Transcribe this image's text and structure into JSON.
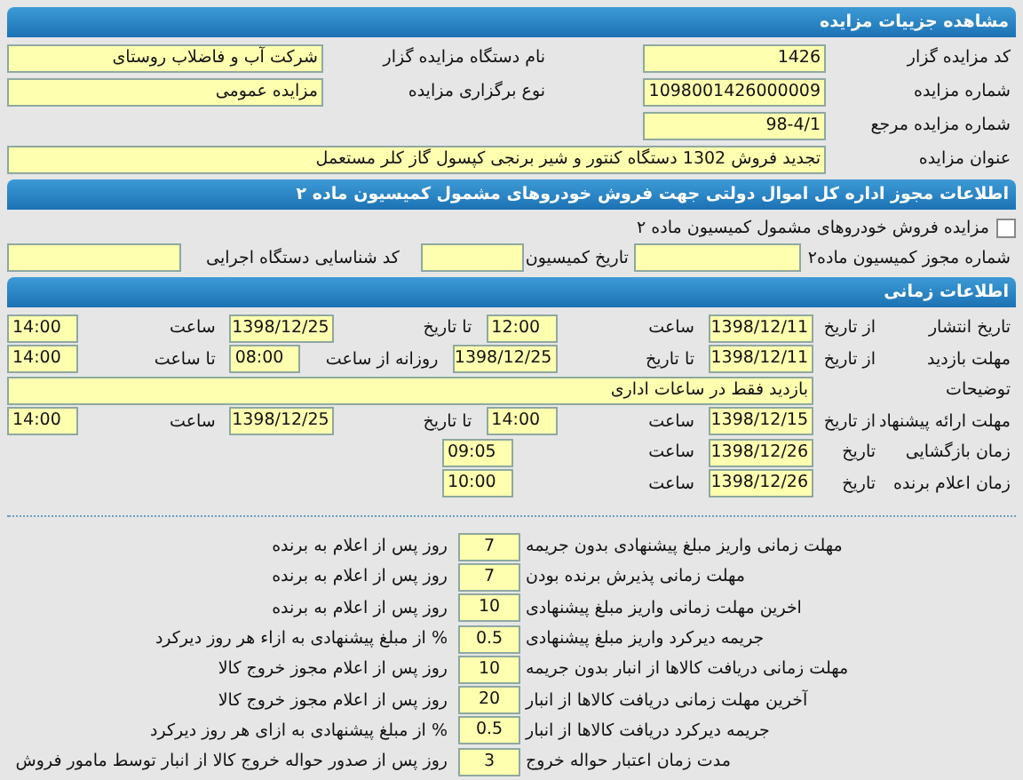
{
  "page_title": "مشاهده جزییات مزایده",
  "general": {
    "right": [
      {
        "label": "کد مزایده گزار",
        "value": "1426"
      },
      {
        "label": "شماره مزایده",
        "value": "1098001426000009"
      },
      {
        "label": "شماره مزایده مرجع",
        "value": "98-4/1"
      }
    ],
    "left": [
      {
        "label": "نام دستگاه مزایده گزار",
        "value": "شرکت آب و فاضلاب روستای"
      },
      {
        "label": "نوع برگزاری مزایده",
        "value": "مزایده عمومی"
      }
    ],
    "subject": {
      "label": "عنوان مزایده",
      "value": "تجدید فروش 1302 دستگاه کنتور و شیر برنجی کپسول گاز کلر مستعمل"
    }
  },
  "commission": {
    "title": "اطلاعات مجوز اداره کل اموال دولتی جهت فروش خودروهای مشمول کمیسیون ماده ۲",
    "checkbox": {
      "label": "مزایده فروش خودروهای مشمول کمیسیون ماده ۲",
      "checked": false
    },
    "fields": [
      {
        "label": "شماره مجوز کمیسیون ماده۲"
      },
      {
        "label": "تاریخ کمیسیون"
      },
      {
        "label": "کد شناسایی دستگاه اجرایی"
      }
    ]
  },
  "schedule": {
    "title": "اطلاعات زمانی",
    "rows": [
      {
        "label": "تاریخ انتشار",
        "parts": [
          {
            "kind": "text",
            "text": "از تاریخ"
          },
          {
            "kind": "date",
            "value": "1398/12/11"
          },
          {
            "kind": "text",
            "text": "ساعت"
          },
          {
            "kind": "time",
            "value": "12:00"
          },
          {
            "kind": "text",
            "text": "تا تاریخ"
          },
          {
            "kind": "date",
            "value": "1398/12/25"
          },
          {
            "kind": "text",
            "text": "ساعت"
          },
          {
            "kind": "time",
            "value": "14:00"
          }
        ]
      },
      {
        "label": "مهلت بازدید",
        "parts": [
          {
            "kind": "text",
            "text": "از تاریخ"
          },
          {
            "kind": "date",
            "value": "1398/12/11"
          },
          {
            "kind": "text",
            "text": "تا تاریخ"
          },
          {
            "kind": "date",
            "value": "1398/12/25"
          },
          {
            "kind": "text",
            "text": "روزانه از ساعت"
          },
          {
            "kind": "time",
            "value": "08:00"
          },
          {
            "kind": "text",
            "text": "تا ساعت"
          },
          {
            "kind": "time",
            "value": "14:00"
          }
        ]
      },
      {
        "label": "توضیحات",
        "parts": [
          {
            "kind": "wide",
            "value": "بازدید فقط در ساعات اداری"
          }
        ]
      },
      {
        "label": "مهلت ارائه پیشنهاد",
        "parts": [
          {
            "kind": "text",
            "text": "از تاریخ"
          },
          {
            "kind": "date",
            "value": "1398/12/15"
          },
          {
            "kind": "text",
            "text": "ساعت"
          },
          {
            "kind": "time",
            "value": "14:00"
          },
          {
            "kind": "text",
            "text": "تا تاریخ"
          },
          {
            "kind": "date",
            "value": "1398/12/25"
          },
          {
            "kind": "text",
            "text": "ساعت"
          },
          {
            "kind": "time",
            "value": "14:00"
          }
        ]
      },
      {
        "label": "زمان بازگشایی",
        "parts": [
          {
            "kind": "text",
            "text": "تاریخ"
          },
          {
            "kind": "date",
            "value": "1398/12/26"
          },
          {
            "kind": "text",
            "text": "ساعت"
          },
          {
            "kind": "time",
            "value": "09:05"
          }
        ]
      },
      {
        "label": "زمان اعلام برنده",
        "parts": [
          {
            "kind": "text",
            "text": "تاریخ"
          },
          {
            "kind": "date",
            "value": "1398/12/26"
          },
          {
            "kind": "text",
            "text": "ساعت"
          },
          {
            "kind": "time",
            "value": "10:00"
          }
        ]
      }
    ]
  },
  "terms": [
    {
      "label": "مهلت زمانی واریز مبلغ پیشنهادی بدون جریمه",
      "value": "7",
      "suffix": "روز پس از اعلام به برنده"
    },
    {
      "label": "مهلت زمانی پذیرش برنده بودن",
      "value": "7",
      "suffix": "روز پس از اعلام به برنده"
    },
    {
      "label": "اخرین مهلت زمانی واریز مبلغ پیشنهادی",
      "value": "10",
      "suffix": "روز پس از اعلام به برنده"
    },
    {
      "label": "جریمه دیرکرد واریز مبلغ پیشنهادی",
      "value": "0.5",
      "suffix": "% از مبلغ پیشنهادی به ازاء هر روز دیرکرد"
    },
    {
      "label": "مهلت زمانی دریافت کالاها از انبار بدون جریمه",
      "value": "10",
      "suffix": "روز پس از اعلام مجوز خروج کالا"
    },
    {
      "label": "آخرین مهلت زمانی دریافت کالاها از انبار",
      "value": "20",
      "suffix": "روز پس از اعلام مجوز خروج کالا"
    },
    {
      "label": "جریمه دیرکرد دریافت کالاها از انبار",
      "value": "0.5",
      "suffix": "% از مبلغ پیشنهادی به ازای هر روز دیرکرد"
    },
    {
      "label": "مدت زمان اعتبار حواله خروج",
      "value": "3",
      "suffix": "روز پس از صدور حواله خروج کالا از انبار توسط مامور فروش"
    }
  ]
}
